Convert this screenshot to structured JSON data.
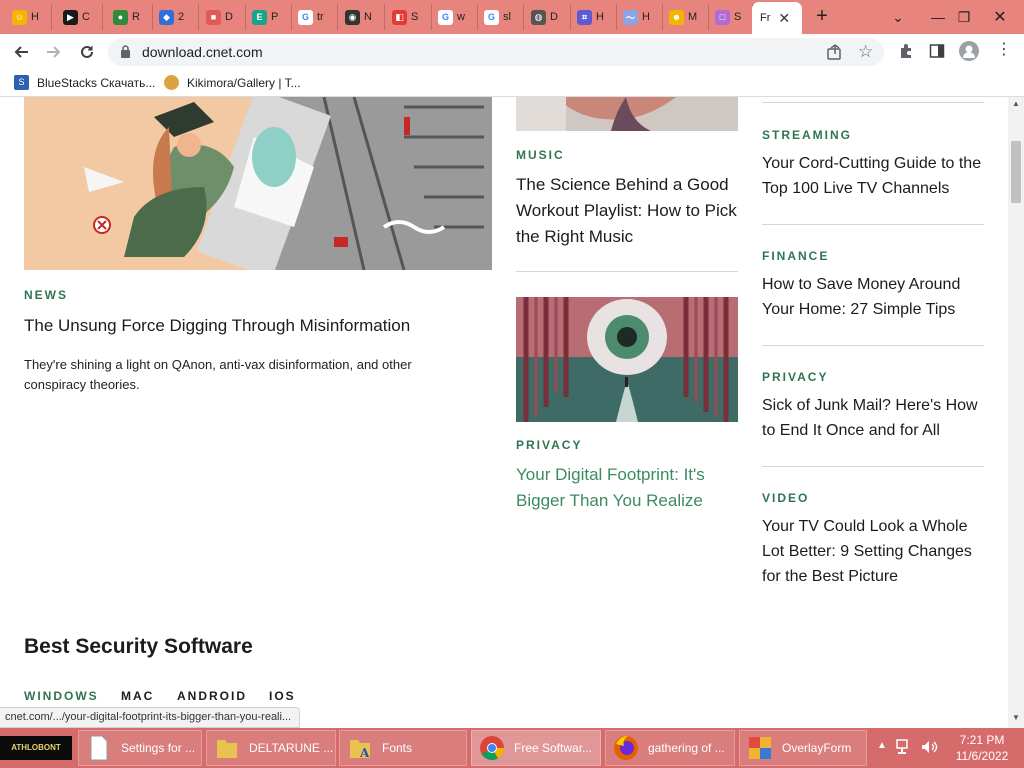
{
  "browser": {
    "tabs": [
      {
        "label": "H",
        "color": "#f5b400",
        "glyph": "☺"
      },
      {
        "label": "C",
        "color": "#1a1a1a",
        "glyph": "▶"
      },
      {
        "label": "R",
        "color": "#2e8b3a",
        "glyph": "●"
      },
      {
        "label": "2",
        "color": "#2f6fdc",
        "glyph": "◆"
      },
      {
        "label": "D",
        "color": "#e05a5a",
        "glyph": "■"
      },
      {
        "label": "P",
        "color": "#1aa38b",
        "glyph": "E"
      },
      {
        "label": "tr",
        "color": "#ffffff",
        "glyph": "G"
      },
      {
        "label": "N",
        "color": "#333333",
        "glyph": "◉"
      },
      {
        "label": "S",
        "color": "#e53935",
        "glyph": "◧"
      },
      {
        "label": "w",
        "color": "#ffffff",
        "glyph": "G"
      },
      {
        "label": "sl",
        "color": "#ffffff",
        "glyph": "G"
      },
      {
        "label": "D",
        "color": "#555555",
        "glyph": "◍"
      },
      {
        "label": "H",
        "color": "#5b5bd6",
        "glyph": "⌗"
      },
      {
        "label": "H",
        "color": "#8aa4e6",
        "glyph": "〜"
      },
      {
        "label": "M",
        "color": "#f5b400",
        "glyph": "☻"
      },
      {
        "label": "S",
        "color": "#b36bd4",
        "glyph": "□"
      }
    ],
    "active_tab": {
      "label": "Fr",
      "close": "✕"
    },
    "new_tab": "+",
    "url": "download.cnet.com",
    "bookmarks": [
      {
        "label": "BlueStacks Скачать...",
        "color": "#2f5fb3"
      },
      {
        "label": "Kikimora/Gallery | T...",
        "color": "#d9a441"
      }
    ]
  },
  "page": {
    "left_story": {
      "category": "NEWS",
      "headline": "The Unsung Force Digging Through Misinformation",
      "summary": "They're shining a light on QAnon, anti-vax disinformation, and other conspiracy theories."
    },
    "middle_stories": [
      {
        "category": "MUSIC",
        "headline": "The Science Behind a Good Workout Playlist: How to Pick the Right Music"
      },
      {
        "category": "PRIVACY",
        "headline": "Your Digital Footprint: It's Bigger Than You Realize"
      }
    ],
    "right_stories": [
      {
        "category": "STREAMING",
        "headline": "Your Cord-Cutting Guide to the Top 100 Live TV Channels"
      },
      {
        "category": "FINANCE",
        "headline": "How to Save Money Around Your Home: 27 Simple Tips"
      },
      {
        "category": "PRIVACY",
        "headline": "Sick of Junk Mail? Here's How to End It Once and for All"
      },
      {
        "category": "VIDEO",
        "headline": "Your TV Could Look a Whole Lot Better: 9 Setting Changes for the Best Picture"
      }
    ],
    "section_title": "Best Security Software",
    "platform_tabs": [
      "WINDOWS",
      "MAC",
      "ANDROID",
      "IOS"
    ]
  },
  "status_url": "cnet.com/.../your-digital-footprint-its-bigger-than-you-reali...",
  "taskbar": {
    "start_label": "ATHLOBONT",
    "items": [
      {
        "label": "Settings for ..."
      },
      {
        "label": "DELTARUNE ..."
      },
      {
        "label": "Fonts"
      },
      {
        "label": "Free Softwar..."
      },
      {
        "label": "gathering of ..."
      },
      {
        "label": "OverlayForm"
      }
    ],
    "time": "7:21 PM",
    "date": "11/6/2022"
  },
  "colors": {
    "accent_green": "#2f7552",
    "link_hover_green": "#3d8a62",
    "tabstrip": "#e8847e",
    "taskbar": "#d56b6b"
  }
}
